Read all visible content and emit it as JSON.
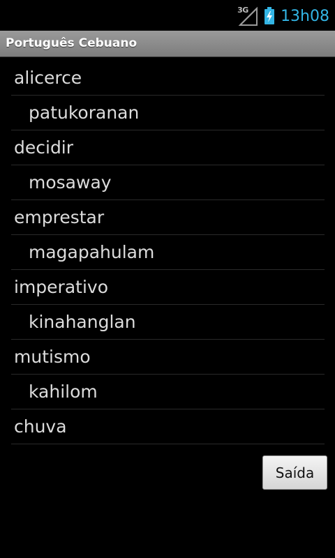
{
  "status_bar": {
    "network_type": "3G",
    "clock": "13h08",
    "signal_icon": "signal-strength-icon",
    "battery_icon": "battery-charging-icon",
    "clock_color": "#33b5e5"
  },
  "title_bar": {
    "title": "Português Cebuano"
  },
  "word_list": [
    {
      "type": "term",
      "text": "alicerce"
    },
    {
      "type": "translation",
      "text": "patukoranan"
    },
    {
      "type": "term",
      "text": "decidir"
    },
    {
      "type": "translation",
      "text": "mosaway"
    },
    {
      "type": "term",
      "text": "emprestar"
    },
    {
      "type": "translation",
      "text": "magapahulam"
    },
    {
      "type": "term",
      "text": "imperativo"
    },
    {
      "type": "translation",
      "text": "kinahanglan"
    },
    {
      "type": "term",
      "text": "mutismo"
    },
    {
      "type": "translation",
      "text": "kahilom"
    },
    {
      "type": "term",
      "text": "chuva"
    }
  ],
  "exit_button": {
    "label": "Saída"
  }
}
